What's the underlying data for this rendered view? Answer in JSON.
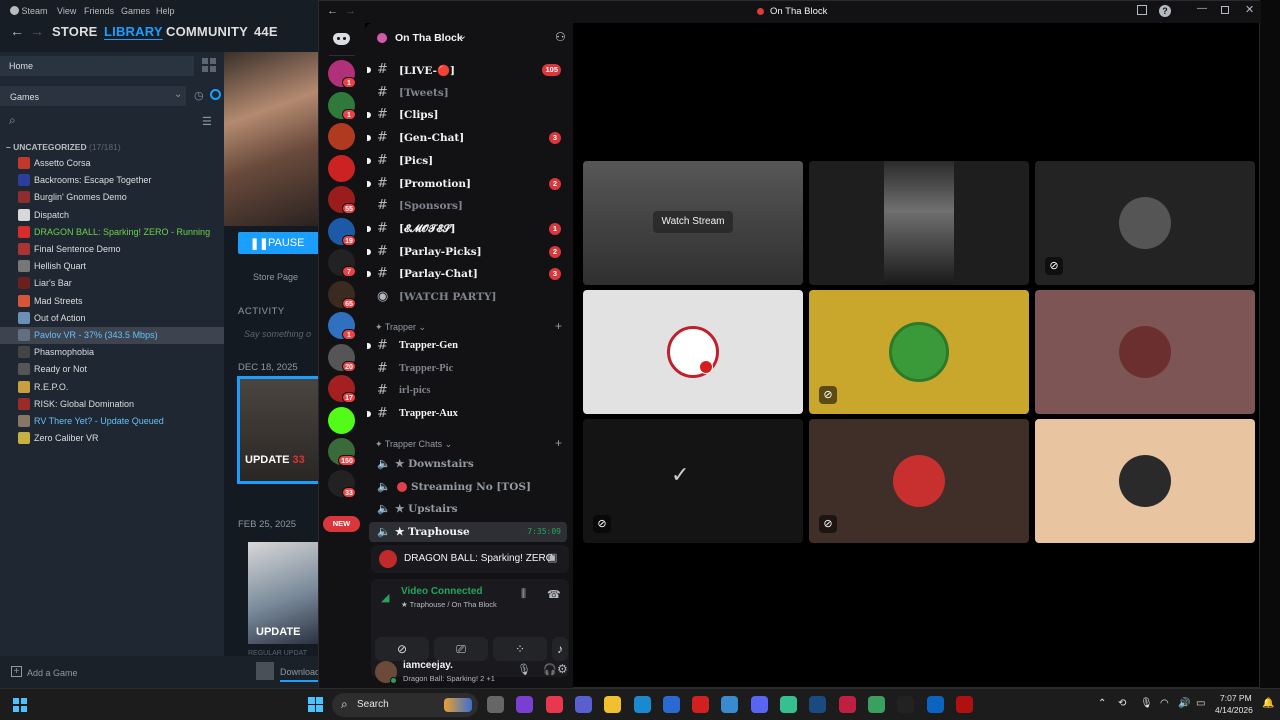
{
  "steam": {
    "menu": [
      "Steam",
      "View",
      "Friends",
      "Games",
      "Help"
    ],
    "nav": {
      "store": "STORE",
      "library": "LIBRARY",
      "community": "COMMUNITY",
      "user": "44E"
    },
    "home": "Home",
    "filter": "Games",
    "category": "UNCATEGORIZED",
    "category_count": "(17/181)",
    "games": [
      {
        "name": "Assetto Corsa",
        "status": "",
        "color": "#c0392b"
      },
      {
        "name": "Backrooms: Escape Together",
        "status": "",
        "color": "#2c3e9a"
      },
      {
        "name": "Burglin' Gnomes Demo",
        "status": "",
        "color": "#8e2d2d"
      },
      {
        "name": "Dispatch",
        "status": "",
        "color": "#d8d8d8"
      },
      {
        "name": "DRAGON BALL: Sparking! ZERO",
        "status": " - Running",
        "color": "#d62c2c"
      },
      {
        "name": "Final Sentence Demo",
        "status": "",
        "color": "#a33"
      },
      {
        "name": "Hellish Quart",
        "status": "",
        "color": "#777"
      },
      {
        "name": "Liar's Bar",
        "status": "",
        "color": "#6b1f1f"
      },
      {
        "name": "Mad Streets",
        "status": "",
        "color": "#d8553a"
      },
      {
        "name": "Out of Action",
        "status": "",
        "color": "#6c8fb5"
      },
      {
        "name": "Pavlov VR",
        "status": " - 37% (343.5 Mbps)",
        "color": "#607080"
      },
      {
        "name": "Phasmophobia",
        "status": "",
        "color": "#444"
      },
      {
        "name": "Ready or Not",
        "status": "",
        "color": "#555"
      },
      {
        "name": "R.E.P.O.",
        "status": "",
        "color": "#c8a040"
      },
      {
        "name": "RISK: Global Domination",
        "status": "",
        "color": "#9a2b2b"
      },
      {
        "name": "RV There Yet?",
        "status": " - Update Queued",
        "color": "#887766"
      },
      {
        "name": "Zero Caliber VR",
        "status": "",
        "color": "#c8b040"
      }
    ],
    "pause_label": "PAUSE",
    "store_page": "Store Page",
    "activity": "ACTIVITY",
    "say_something": "Say something o",
    "date1": "DEC 18, 2025",
    "update_badge": "UPDATE",
    "date2": "FEB 25, 2025",
    "update_badge2": "UPDATE",
    "regular_update": "REGULAR UPDAT",
    "add_game": "Add a Game",
    "download": "Download"
  },
  "discord": {
    "window_title": "On Tha Block",
    "server_name": "On Tha Block",
    "servers": [
      {
        "badge": "1",
        "color": "#b0307a"
      },
      {
        "badge": "1",
        "color": "#2f7a3a"
      },
      {
        "badge": "",
        "color": "#b03a20"
      },
      {
        "badge": "",
        "color": "#c22"
      },
      {
        "badge": "55",
        "color": "#9b1c1c"
      },
      {
        "badge": "19",
        "color": "#1c5aa8"
      },
      {
        "badge": "7",
        "color": "#222"
      },
      {
        "badge": "65",
        "color": "#3a2a20"
      },
      {
        "badge": "1",
        "color": "#3070c0"
      },
      {
        "badge": "20",
        "color": "#555"
      },
      {
        "badge": "17",
        "color": "#a42020"
      },
      {
        "badge": "",
        "color": "#53fc18"
      },
      {
        "badge": "150",
        "color": "#3a6a3a"
      },
      {
        "badge": "33",
        "color": "#222"
      }
    ],
    "new_label": "NEW",
    "channels": [
      {
        "name": "[LIVE-🔴]",
        "badge": "105",
        "unread": true
      },
      {
        "name": "[Tweets]",
        "badge": "",
        "unread": false
      },
      {
        "name": "[Clips]",
        "badge": "",
        "unread": true
      },
      {
        "name": "[Gen-Chat]",
        "badge": "3",
        "unread": true
      },
      {
        "name": "[Pics]",
        "badge": "",
        "unread": true
      },
      {
        "name": "[Promotion]",
        "badge": "2",
        "unread": true
      },
      {
        "name": "[Sponsors]",
        "badge": "",
        "unread": false
      },
      {
        "name": "[𝓔𝓜𝓞𝓣𝓔𝓢]",
        "badge": "1",
        "unread": true
      },
      {
        "name": "[Parlay-Picks]",
        "badge": "2",
        "unread": true
      },
      {
        "name": "[Parlay-Chat]",
        "badge": "3",
        "unread": true
      },
      {
        "name": "[WATCH PARTY]",
        "badge": "",
        "unread": false
      }
    ],
    "cat1": "Trapper",
    "trapper_channels": [
      {
        "name": "Trapper-Gen",
        "unread": true
      },
      {
        "name": "Trapper-Pic",
        "unread": false
      },
      {
        "name": "irl-pics",
        "unread": false
      },
      {
        "name": "Trapper-Aux",
        "unread": true
      }
    ],
    "cat2": "Trapper Chats",
    "voice_channels": [
      {
        "name": "★ Downstairs",
        "extra": ""
      },
      {
        "name": "Streaming No [TOS]",
        "extra": ""
      },
      {
        "name": "★ Upstairs",
        "extra": ""
      },
      {
        "name": "★ Traphouse",
        "extra": "7:35:09"
      }
    ],
    "activity_game": "DRAGON BALL: Sparking! ZERO",
    "connection_status": "Video Connected",
    "connection_channel": "★ Traphouse / On Tha Block",
    "username": "iamceejay.",
    "user_status": "Dragon Ball: Sparking! 2 +1",
    "watch_stream": "Watch Stream",
    "tiles": [
      {
        "bg": "#3a3a3a",
        "kind": "stream"
      },
      {
        "bg": "#1e1e1e",
        "kind": "car"
      },
      {
        "bg": "#232323",
        "kind": "avatar",
        "muted": true
      },
      {
        "bg": "#e2e2e2",
        "kind": "logo"
      },
      {
        "bg": "#c9a62c",
        "kind": "avatar-green",
        "muted": true
      },
      {
        "bg": "#7d5555",
        "kind": "avatar",
        "muted": false
      },
      {
        "bg": "#141414",
        "kind": "nike",
        "muted": true
      },
      {
        "bg": "#3f2f28",
        "kind": "avatar",
        "muted": true
      },
      {
        "bg": "#e8c4a0",
        "kind": "avatar",
        "muted": false
      }
    ]
  },
  "taskbar": {
    "search": "Search",
    "time": "7:07 PM",
    "date": "4/14/2026"
  }
}
